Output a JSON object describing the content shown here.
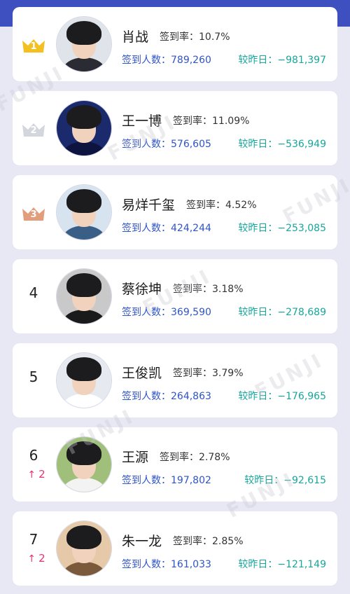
{
  "labels": {
    "rate_label": "签到率：",
    "count_label": "签到人数：",
    "change_label": "较昨日："
  },
  "watermark_text": "FUNJI",
  "items": [
    {
      "rank": "1",
      "badge": "gold",
      "name": "肖战",
      "rate": "10.7%",
      "count": "789,260",
      "change": "−981,397",
      "avatar_bg": "#dfe3ea",
      "avatar_body": "#2b2b33"
    },
    {
      "rank": "2",
      "badge": "silver",
      "name": "王一博",
      "rate": "11.09%",
      "count": "576,605",
      "change": "−536,949",
      "avatar_bg": "#1a2a6c",
      "avatar_body": "#0d1440"
    },
    {
      "rank": "3",
      "badge": "bronze",
      "name": "易烊千玺",
      "rate": "4.52%",
      "count": "424,244",
      "change": "−253,085",
      "avatar_bg": "#d7e3ef",
      "avatar_body": "#3a5f86"
    },
    {
      "rank": "4",
      "badge": "",
      "name": "蔡徐坤",
      "rate": "3.18%",
      "count": "369,590",
      "change": "−278,689",
      "avatar_bg": "#c9c9c9",
      "avatar_body": "#1a1a1a"
    },
    {
      "rank": "5",
      "badge": "",
      "name": "王俊凯",
      "rate": "3.79%",
      "count": "264,863",
      "change": "−176,965",
      "avatar_bg": "#e6e9ef",
      "avatar_body": "#ffffff"
    },
    {
      "rank": "6",
      "badge": "",
      "rank_change": "2",
      "name": "王源",
      "rate": "2.78%",
      "count": "197,802",
      "change": "−92,615",
      "avatar_bg": "#9fbf7a",
      "avatar_body": "#f3f3f3"
    },
    {
      "rank": "7",
      "badge": "",
      "rank_change": "2",
      "name": "朱一龙",
      "rate": "2.85%",
      "count": "161,033",
      "change": "−121,149",
      "avatar_bg": "#e6c9a8",
      "avatar_body": "#7a5a3a"
    }
  ],
  "colors": {
    "gold": "#f3c021",
    "silver": "#d3d6dd",
    "bronze": "#e29d7a",
    "count_blue": "#2f54c7",
    "change_teal": "#17a79b",
    "rank_up_red": "#e8336d",
    "header_blue": "#3e4fbf"
  }
}
